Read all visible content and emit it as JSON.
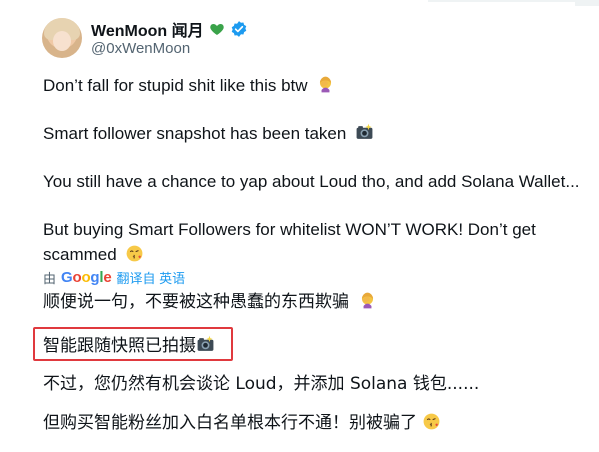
{
  "author": {
    "display_name": "WenMoon 闻月",
    "handle": "@0xWenMoon",
    "heart_icon": "green-heart-icon",
    "verified_icon": "verified-badge-icon",
    "verified_color": "#1d9bf0"
  },
  "tweet": {
    "p1": "Don’t fall for stupid shit like this btw",
    "p2": "Smart follower snapshot has been taken",
    "p3": "You still have a chance to yap about Loud tho, and add Solana Wallet...",
    "p4": "But buying Smart Followers for whitelist WON’T WORK! Don’t get scammed"
  },
  "translation": {
    "by": "由",
    "provider": "Google",
    "action": "翻译自 英语",
    "lines": [
      "顺便说一句，不要被这种愚蠢的东西欺骗",
      "智能跟随快照已拍摄",
      "不过，您仍然有机会谈论 Loud，并添加 Solana 钱包......",
      "但购买智能粉丝加入白名单根本行不通！别被骗了"
    ]
  },
  "colors": {
    "text": "#0f1419",
    "muted": "#536471",
    "link": "#1d9bf0",
    "highlight": "#e0393e"
  }
}
